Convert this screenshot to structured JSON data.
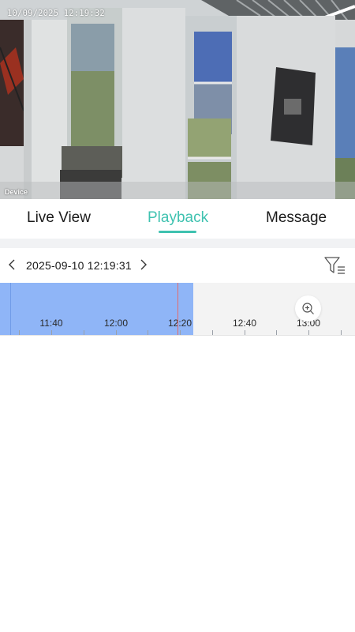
{
  "video": {
    "timestamp": "10/09/2025 12:19:32",
    "device_label": "Device"
  },
  "tabs": [
    {
      "label": "Live View",
      "active": false
    },
    {
      "label": "Playback",
      "active": true
    },
    {
      "label": "Message",
      "active": false
    }
  ],
  "date_bar": {
    "datetime": "2025-09-10 12:19:31",
    "prev_icon": "chevron-left-icon",
    "next_icon": "chevron-right-icon",
    "filter_icon": "filter-list-icon"
  },
  "timeline": {
    "ticks": [
      "11:40",
      "12:00",
      "12:20",
      "12:40",
      "13:00"
    ],
    "zoom_icon": "zoom-in-icon"
  },
  "colors": {
    "accent": "#3fc2b0",
    "recorded_segment": "#8fb5f7",
    "cursor": "#e56a6a"
  }
}
